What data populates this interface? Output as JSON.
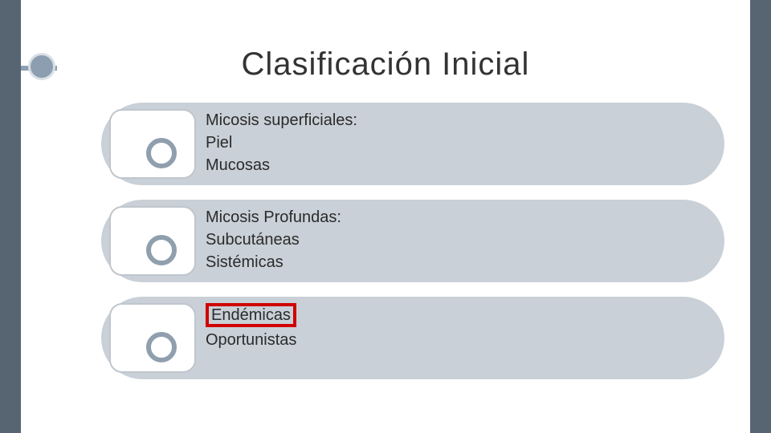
{
  "title": "Clasificación Inicial",
  "rows": [
    {
      "l1": "Micosis superficiales:",
      "l2": "Piel",
      "l3": "Mucosas"
    },
    {
      "l1": "Micosis Profundas:",
      "l2": "Subcutáneas",
      "l3": "Sistémicas"
    },
    {
      "l1": "Endémicas",
      "l2": "Oportunistas",
      "l3": "",
      "highlight_first": true
    }
  ]
}
